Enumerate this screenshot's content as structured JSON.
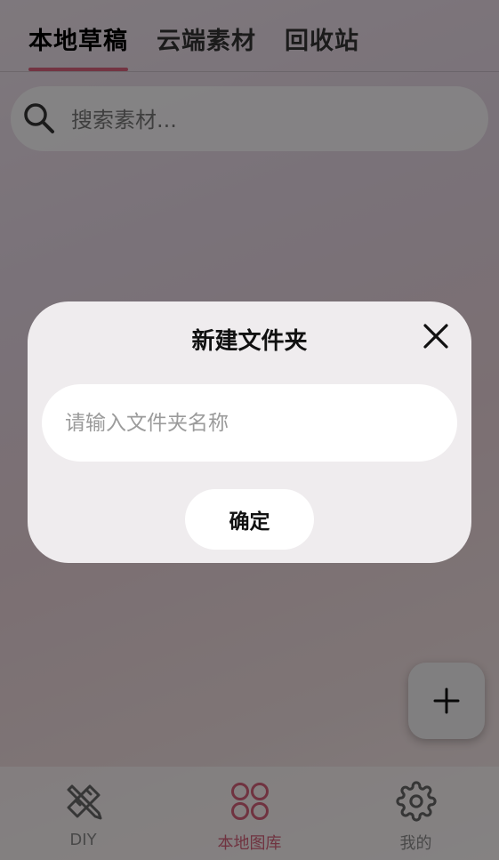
{
  "tabs": [
    {
      "label": "本地草稿",
      "active": true
    },
    {
      "label": "云端素材",
      "active": false
    },
    {
      "label": "回收站",
      "active": false
    }
  ],
  "search": {
    "placeholder": "搜索素材..."
  },
  "fab": {
    "icon": "plus-icon"
  },
  "bottom_nav": [
    {
      "label": "DIY",
      "icon": "pencil-ruler-icon",
      "active": false
    },
    {
      "label": "本地图库",
      "icon": "grid-circles-icon",
      "active": true
    },
    {
      "label": "我的",
      "icon": "gear-icon",
      "active": false
    }
  ],
  "dialog": {
    "title": "新建文件夹",
    "input_placeholder": "请输入文件夹名称",
    "confirm_label": "确定"
  },
  "colors": {
    "accent": "#d9627d",
    "dialog_bg": "#efecee"
  }
}
